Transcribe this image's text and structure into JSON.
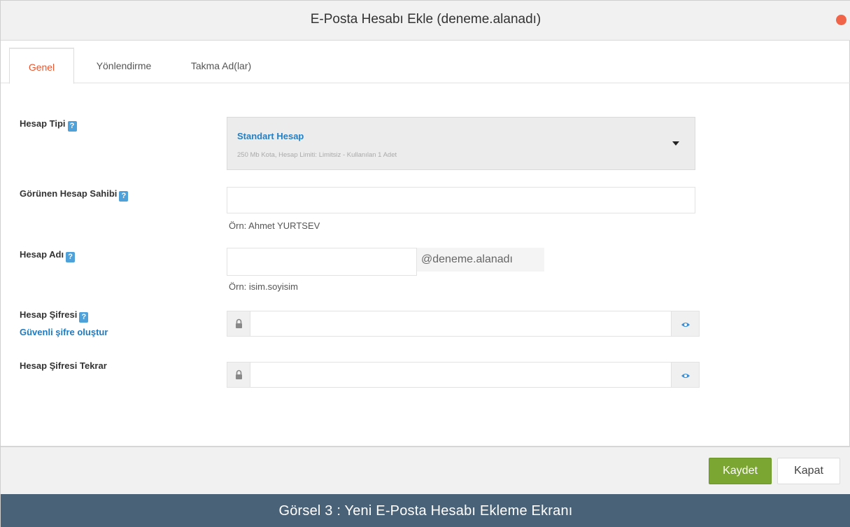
{
  "window": {
    "title": "E-Posta Hesabı Ekle (deneme.alanadı)"
  },
  "tabs": [
    {
      "label": "Genel",
      "active": true
    },
    {
      "label": "Yönlendirme",
      "active": false
    },
    {
      "label": "Takma Ad(lar)",
      "active": false
    }
  ],
  "form": {
    "help_marker": "?",
    "account_type": {
      "label": "Hesap Tipi",
      "selected": "Standart Hesap",
      "description": "250 Mb Kota, Hesap Limiti: Limitsiz - Kullanılan 1 Adet"
    },
    "display_name": {
      "label": "Görünen Hesap Sahibi",
      "value": "",
      "hint": "Örn: Ahmet YURTSEV"
    },
    "account_name": {
      "label": "Hesap Adı",
      "value": "",
      "suffix": "@deneme.alanadı",
      "hint": "Örn: isim.soyisim"
    },
    "password": {
      "label": "Hesap Şifresi",
      "link": "Güvenli şifre oluştur",
      "value": ""
    },
    "password_repeat": {
      "label": "Hesap Şifresi Tekrar",
      "value": ""
    }
  },
  "footer": {
    "save_label": "Kaydet",
    "close_label": "Kapat"
  },
  "caption": "Görsel 3 : Yeni E-Posta Hesabı Ekleme Ekranı",
  "colors": {
    "accent_tab": "#e8562f",
    "link_blue": "#1f7ac0",
    "save_green": "#7ba632",
    "caption_bg": "#4a6277",
    "close_dot": "#f0654a"
  },
  "icons": {
    "lock": "lock-icon",
    "eye": "eye-icon",
    "help": "help-icon",
    "close": "close-icon",
    "dropdown": "chevron-down-icon"
  }
}
